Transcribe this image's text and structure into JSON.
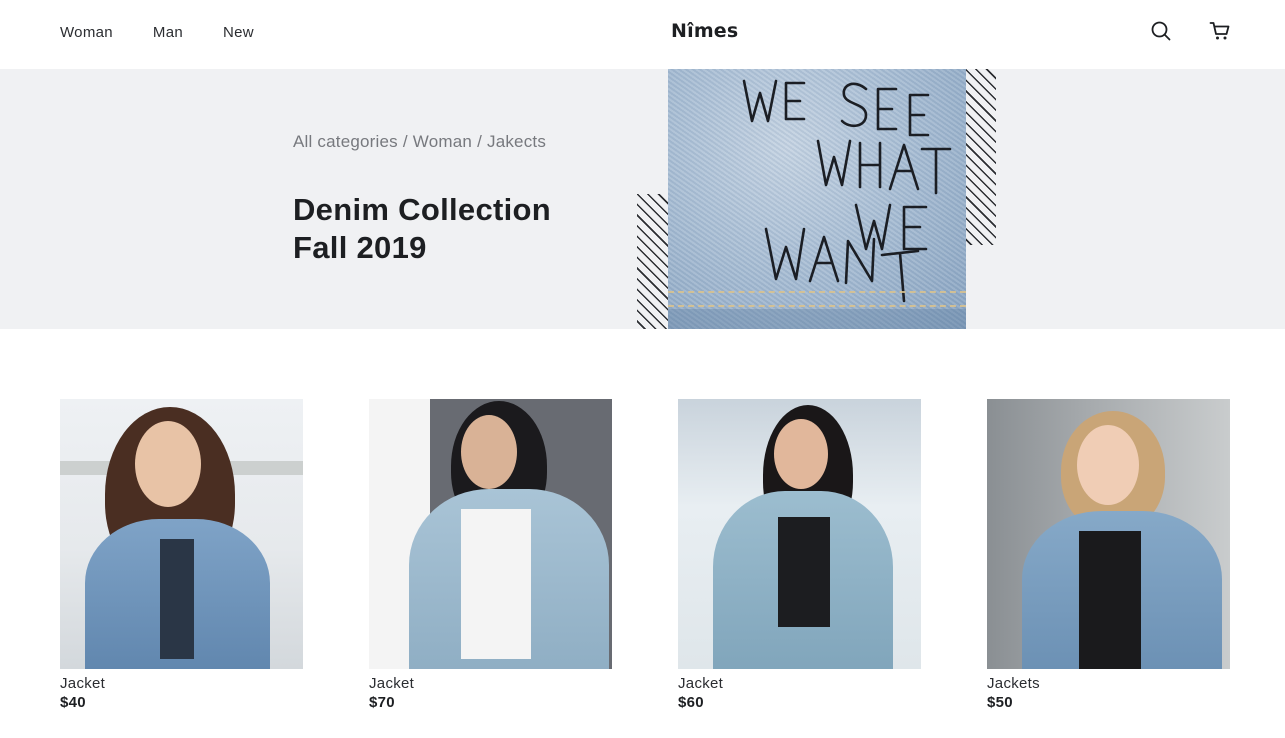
{
  "header": {
    "nav": [
      {
        "label": "Woman"
      },
      {
        "label": "Man"
      },
      {
        "label": "New"
      }
    ],
    "logo": "Nîmes",
    "icons": {
      "search": "search-icon",
      "cart": "cart-icon"
    }
  },
  "hero": {
    "breadcrumb": [
      {
        "label": "All categories"
      },
      {
        "label": "Woman"
      },
      {
        "label": "Jakects"
      }
    ],
    "separator": "/",
    "title_line1": "Denim Collection",
    "title_line2": "Fall 2019",
    "image_text": "WE SEE WHAT WE WANT"
  },
  "products": [
    {
      "name": "Jacket",
      "price": "$40"
    },
    {
      "name": "Jacket",
      "price": "$70"
    },
    {
      "name": "Jacket",
      "price": "$60"
    },
    {
      "name": "Jackets",
      "price": "$50"
    }
  ],
  "colors": {
    "hero_bg": "#f0f1f3",
    "text": "#1d1f22",
    "muted": "#77797e"
  }
}
